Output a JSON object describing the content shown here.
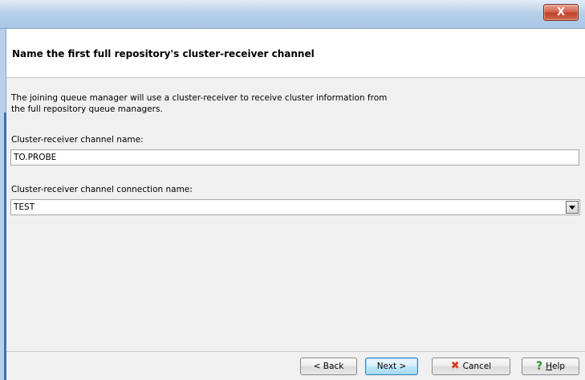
{
  "window": {
    "close_glyph": "X"
  },
  "header": {
    "title": "Name the first full repository's cluster-receiver channel"
  },
  "content": {
    "description": "The joining queue manager will use a cluster-receiver to receive cluster information from the full repository queue managers.",
    "channel_name": {
      "label": "Cluster-receiver channel name:",
      "value": "TO.PROBE"
    },
    "connection_name": {
      "label": "Cluster-receiver channel connection name:",
      "value": "TEST"
    }
  },
  "buttons": {
    "back": "< Back",
    "next": "Next >",
    "cancel": "Cancel",
    "help_mnemonic": "H",
    "help_rest": "elp"
  },
  "icons": {
    "cancel": "cross-icon",
    "help": "question-icon",
    "combo": "dropdown-arrow-icon"
  },
  "colors": {
    "titlebar": "#b7cfea",
    "close": "#c04128",
    "default_button": "#bee6fd"
  }
}
